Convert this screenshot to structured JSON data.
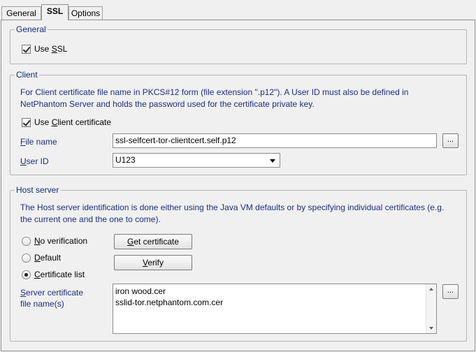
{
  "tabs": [
    {
      "label": "General"
    },
    {
      "label": "SSL"
    },
    {
      "label": "Options"
    }
  ],
  "general": {
    "title": "General",
    "use_ssl": {
      "label_pre": "Use ",
      "label_ul": "S",
      "label_post": "SL",
      "checked": true
    }
  },
  "client": {
    "title": "Client",
    "desc1": "For Client certificate file name in PKCS#12 form (file extension \".p12\"). A User ID must also be defined in",
    "desc2": "NetPhantom Server and holds the password used for the certificate private key.",
    "use_cert": {
      "label_pre": "Use ",
      "label_ul": "C",
      "label_post": "lient certificate",
      "checked": true
    },
    "file_name": {
      "label_ul": "F",
      "label_post": "ile name",
      "value": "ssl-selfcert-tor-clientcert.self.p12",
      "browse": "..."
    },
    "user_id": {
      "label_ul": "U",
      "label_post": "ser ID",
      "value": "U123"
    }
  },
  "host": {
    "title": "Host server",
    "desc1": "The Host server identification is done either using the Java VM defaults or by specifying individual certificates (e.g.",
    "desc2": "the current one and the one to come).",
    "radios": [
      {
        "label_ul": "N",
        "label_post": "o verification",
        "selected": false
      },
      {
        "label_ul": "D",
        "label_post": "efault",
        "selected": false
      },
      {
        "label_ul": "C",
        "label_post": "ertificate list",
        "selected": true
      }
    ],
    "get_cert": {
      "label_ul": "G",
      "label_post": "et certificate"
    },
    "verify": {
      "label_ul": "V",
      "label_post": "erify"
    },
    "server_cert_label": {
      "label_ul": "S",
      "label_post": "erver certificate",
      "line2": "file name(s)"
    },
    "cert_files": [
      "iron wood.cer",
      "sslid-tor.netphantom.com.cer"
    ],
    "browse": "..."
  }
}
